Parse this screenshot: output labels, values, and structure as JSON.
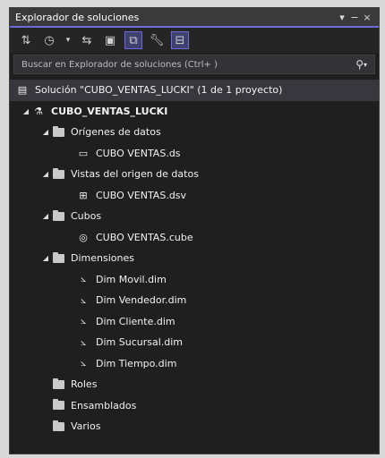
{
  "window": {
    "title": "Explorador de soluciones",
    "controls": [
      "▾",
      "−",
      "×"
    ]
  },
  "toolbar": {
    "icons": [
      "sync-icon",
      "history-icon",
      "dropdown-icon",
      "pending-changes-icon",
      "show-all-files-icon",
      "properties-icon",
      "preview-icon",
      "wrench-icon",
      "collapse-icon"
    ]
  },
  "search": {
    "placeholder": "Buscar en Explorador de soluciones (Ctrl+ )"
  },
  "tree": {
    "solution": "Solución \"CUBO_VENTAS_LUCKI\" (1 de 1 proyecto)",
    "project": "CUBO_VENTAS_LUCKI",
    "folders": {
      "origenes": "Orígenes de datos",
      "vistas": "Vistas del origen de datos",
      "cubos": "Cubos",
      "dimensiones": "Dimensiones",
      "roles": "Roles",
      "ensamblados": "Ensamblados",
      "varios": "Varios"
    },
    "items": {
      "ds": "CUBO VENTAS.ds",
      "dsv": "CUBO VENTAS.dsv",
      "cube": "CUBO VENTAS.cube",
      "dim1": "Dim Movil.dim",
      "dim2": "Dim Vendedor.dim",
      "dim3": "Dim Cliente.dim",
      "dim4": "Dim Sucursal.dim",
      "dim5": "Dim Tiempo.dim"
    }
  },
  "colors": {
    "accent": "#6d6bd8",
    "background": "#1f1f1f",
    "selection": "#37373d"
  }
}
